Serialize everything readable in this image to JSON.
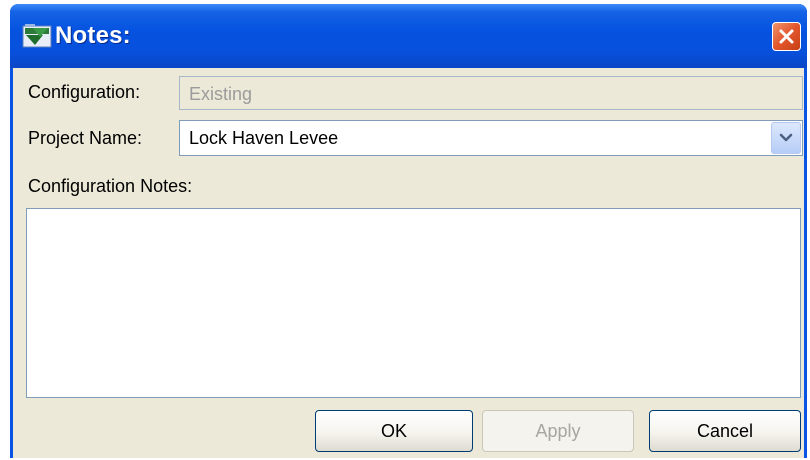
{
  "window": {
    "title": "Notes:",
    "icon": "app-icon",
    "close_icon": "close-icon"
  },
  "form": {
    "configuration_label": "Configuration:",
    "configuration_value": "Existing",
    "project_name_label": "Project Name:",
    "project_name_value": "Lock Haven Levee",
    "dropdown_icon": "chevron-down-icon",
    "notes_label": "Configuration Notes:",
    "notes_value": ""
  },
  "buttons": {
    "ok": "OK",
    "apply": "Apply",
    "apply_enabled": false,
    "cancel": "Cancel"
  },
  "colors": {
    "titlebar": "#0553e0",
    "client": "#ece9d8",
    "close": "#e2562c",
    "field_border": "#7f9db9"
  }
}
